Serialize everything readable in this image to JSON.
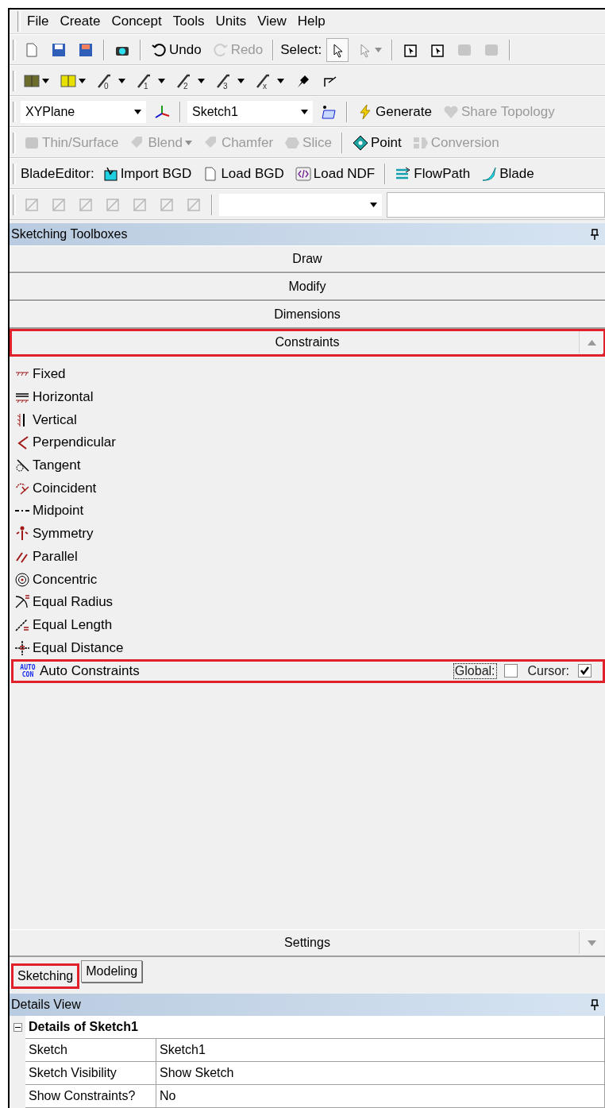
{
  "menu": [
    "File",
    "Create",
    "Concept",
    "Tools",
    "Units",
    "View",
    "Help"
  ],
  "toolbars": [
    {
      "items": [
        {
          "kind": "icon"
        },
        {
          "kind": "icon"
        },
        {
          "kind": "icon"
        },
        {
          "kind": "separator"
        },
        {
          "kind": "icon"
        },
        {
          "kind": "separator"
        },
        {
          "kind": "button",
          "label": "Undo",
          "disabled": false
        },
        {
          "kind": "button",
          "label": "Redo",
          "disabled": true
        },
        {
          "kind": "separator"
        },
        {
          "kind": "label",
          "label": "Select:"
        },
        {
          "kind": "icon",
          "selected": true
        },
        {
          "kind": "icon",
          "disabled": true,
          "caret": true,
          "selected": false
        },
        {
          "kind": "separator"
        },
        {
          "kind": "icon"
        },
        {
          "kind": "icon"
        },
        {
          "kind": "icon",
          "disabled": true
        },
        {
          "kind": "icon",
          "disabled": true
        },
        {
          "kind": "separator"
        }
      ]
    },
    {
      "items": [
        {
          "kind": "icon",
          "caret": true
        },
        {
          "kind": "icon",
          "caret": true
        },
        {
          "kind": "tool",
          "sub": "0",
          "caret": true
        },
        {
          "kind": "tool",
          "sub": "1",
          "caret": true
        },
        {
          "kind": "tool",
          "sub": "2",
          "caret": true
        },
        {
          "kind": "tool",
          "sub": "3",
          "caret": true
        },
        {
          "kind": "tool",
          "sub": "x",
          "caret": true
        },
        {
          "kind": "icon"
        },
        {
          "kind": "icon"
        }
      ]
    },
    {
      "items": [
        {
          "kind": "dropdown",
          "value": "XYPlane"
        },
        {
          "kind": "icon"
        },
        {
          "kind": "separator"
        },
        {
          "kind": "dropdown",
          "value": "Sketch1"
        },
        {
          "kind": "icon"
        },
        {
          "kind": "separator"
        },
        {
          "kind": "button",
          "label": "Generate",
          "disabled": false
        },
        {
          "kind": "button",
          "label": "Share Topology",
          "disabled": true
        }
      ]
    },
    {
      "items": [
        {
          "kind": "button",
          "label": "Thin/Surface",
          "disabled": true
        },
        {
          "kind": "button",
          "label": "Blend",
          "disabled": true,
          "caret": true
        },
        {
          "kind": "button",
          "label": "Chamfer",
          "disabled": true
        },
        {
          "kind": "button",
          "label": "Slice",
          "disabled": true
        },
        {
          "kind": "separator"
        },
        {
          "kind": "button",
          "label": "Point",
          "disabled": false
        },
        {
          "kind": "button",
          "label": "Conversion",
          "disabled": true
        }
      ]
    },
    {
      "items": [
        {
          "kind": "label",
          "label": "BladeEditor:"
        },
        {
          "kind": "button",
          "label": "Import BGD",
          "disabled": false
        },
        {
          "kind": "button",
          "label": "Load BGD",
          "disabled": false
        },
        {
          "kind": "button",
          "label": "Load NDF",
          "disabled": false
        },
        {
          "kind": "separator"
        },
        {
          "kind": "button",
          "label": "FlowPath",
          "disabled": false
        },
        {
          "kind": "button",
          "label": "Blade",
          "disabled": false
        }
      ]
    },
    {
      "items": [
        {
          "kind": "icon",
          "disabled": true
        },
        {
          "kind": "icon",
          "disabled": true
        },
        {
          "kind": "icon",
          "disabled": true
        },
        {
          "kind": "icon",
          "disabled": true
        },
        {
          "kind": "icon",
          "disabled": true
        },
        {
          "kind": "icon",
          "disabled": true
        },
        {
          "kind": "icon",
          "disabled": true
        },
        {
          "kind": "separator"
        },
        {
          "kind": "dropdown"
        },
        {
          "kind": "field"
        }
      ]
    }
  ],
  "toolbox": {
    "title": "Sketching Toolboxes",
    "sections": [
      {
        "label": "Draw",
        "expanded": false,
        "highlighted": false
      },
      {
        "label": "Modify",
        "expanded": false,
        "highlighted": false
      },
      {
        "label": "Dimensions",
        "expanded": false,
        "highlighted": false
      },
      {
        "label": "Constraints",
        "expanded": true,
        "highlighted": true,
        "items": [
          {
            "label": "Fixed"
          },
          {
            "label": "Horizontal"
          },
          {
            "label": "Vertical"
          },
          {
            "label": "Perpendicular"
          },
          {
            "label": "Tangent"
          },
          {
            "label": "Coincident"
          },
          {
            "label": "Midpoint"
          },
          {
            "label": "Symmetry"
          },
          {
            "label": "Parallel"
          },
          {
            "label": "Concentric"
          },
          {
            "label": "Equal Radius"
          },
          {
            "label": "Equal Length"
          },
          {
            "label": "Equal Distance"
          }
        ],
        "auto": {
          "icon_lines": [
            "AUTO",
            "CON"
          ],
          "label": "Auto Constraints",
          "highlighted": true,
          "global": {
            "label": "Global:",
            "checked": false,
            "focused": true
          },
          "cursor": {
            "label": "Cursor:",
            "checked": true,
            "focused": false
          }
        }
      },
      {
        "label": "Settings",
        "expanded": false,
        "highlighted": false
      }
    ]
  },
  "tabs": [
    {
      "label": "Sketching",
      "selected": true,
      "highlighted": true
    },
    {
      "label": "Modeling",
      "selected": false,
      "highlighted": false
    }
  ],
  "details": {
    "title": "Details View",
    "group": {
      "label": "Details of Sketch1",
      "expanded": true
    },
    "rows": [
      {
        "name": "Sketch",
        "value": "Sketch1"
      },
      {
        "name": "Sketch Visibility",
        "value": "Show Sketch"
      },
      {
        "name": "Show Constraints?",
        "value": "No"
      }
    ]
  }
}
